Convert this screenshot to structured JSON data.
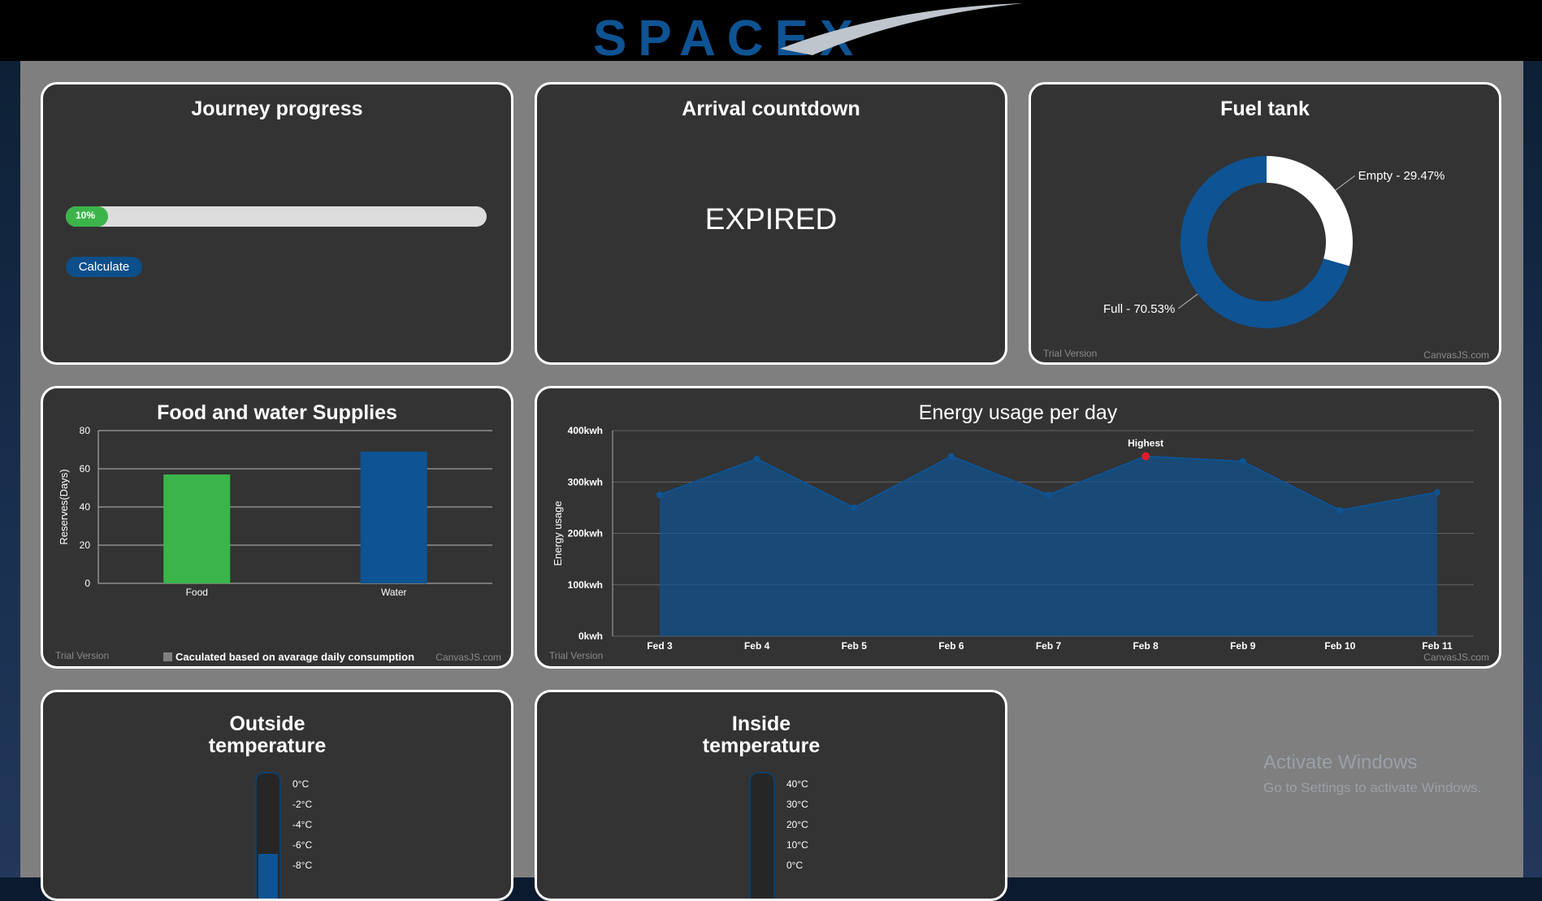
{
  "header": {
    "logo_text": "SPACEX"
  },
  "journey": {
    "title": "Journey progress",
    "progress": 0.1,
    "progress_label": "10%",
    "button_label": "Calculate"
  },
  "countdown": {
    "title": "Arrival countdown",
    "status": "EXPIRED"
  },
  "fuel": {
    "title": "Fuel tank",
    "watermark_left": "Trial Version",
    "watermark_right": "CanvasJS.com",
    "chart_data": {
      "type": "pie",
      "subtype": "doughnut",
      "slices": [
        {
          "label": "Full - 70.53%",
          "value": 70.53,
          "color": "#0e5393"
        },
        {
          "label": "Empty - 29.47%",
          "value": 29.47,
          "color": "#ffffff"
        }
      ]
    }
  },
  "food": {
    "title": "Food and water Supplies",
    "watermark_left": "Trial Version",
    "watermark_right": "CanvasJS.com",
    "legend_label": "Caculated based on avarage daily consumption",
    "legend_color": "#808080",
    "chart_data": {
      "type": "bar",
      "title": "Food and water Supplies",
      "categories": [
        "Food",
        "Water"
      ],
      "values": [
        57,
        69
      ],
      "colors": [
        "#3bb54a",
        "#0e5393"
      ],
      "ylabel": "Reserves(Days)",
      "ylim": [
        0,
        80
      ],
      "yticks": [
        "0",
        "20",
        "40",
        "60",
        "80"
      ],
      "grid": true
    }
  },
  "energy": {
    "title": "Energy usage per day",
    "watermark_left": "Trial Version",
    "watermark_right": "CanvasJS.com",
    "chart_data": {
      "type": "area",
      "title": "Energy usage per day",
      "categories": [
        "Fed 3",
        "Feb 4",
        "Feb 5",
        "Feb 6",
        "Feb 7",
        "Feb 8",
        "Feb 9",
        "Feb 10",
        "Feb 11"
      ],
      "values": [
        275,
        345,
        250,
        350,
        275,
        350,
        340,
        245,
        280
      ],
      "ylabel": "Energy usage",
      "ylim": [
        0,
        400
      ],
      "yticks": [
        "0kwh",
        "100kwh",
        "200kwh",
        "300kwh",
        "400kwh"
      ],
      "highlight_index": 5,
      "highlight_label": "Highest",
      "color": "#0e5393",
      "grid": true
    }
  },
  "outside": {
    "title_line1": "Outside",
    "title_line2": "temperature",
    "scale": [
      "0°C",
      "-2°C",
      "-4°C",
      "-6°C",
      "-8°C"
    ],
    "fill_level": 0.3
  },
  "inside": {
    "title_line1": "Inside",
    "title_line2": "temperature",
    "scale": [
      "40°C",
      "30°C",
      "20°C",
      "10°C",
      "0°C"
    ],
    "fill_level": 0
  },
  "windows": {
    "line1": "Activate Windows",
    "line2": "Go to Settings to activate Windows."
  }
}
